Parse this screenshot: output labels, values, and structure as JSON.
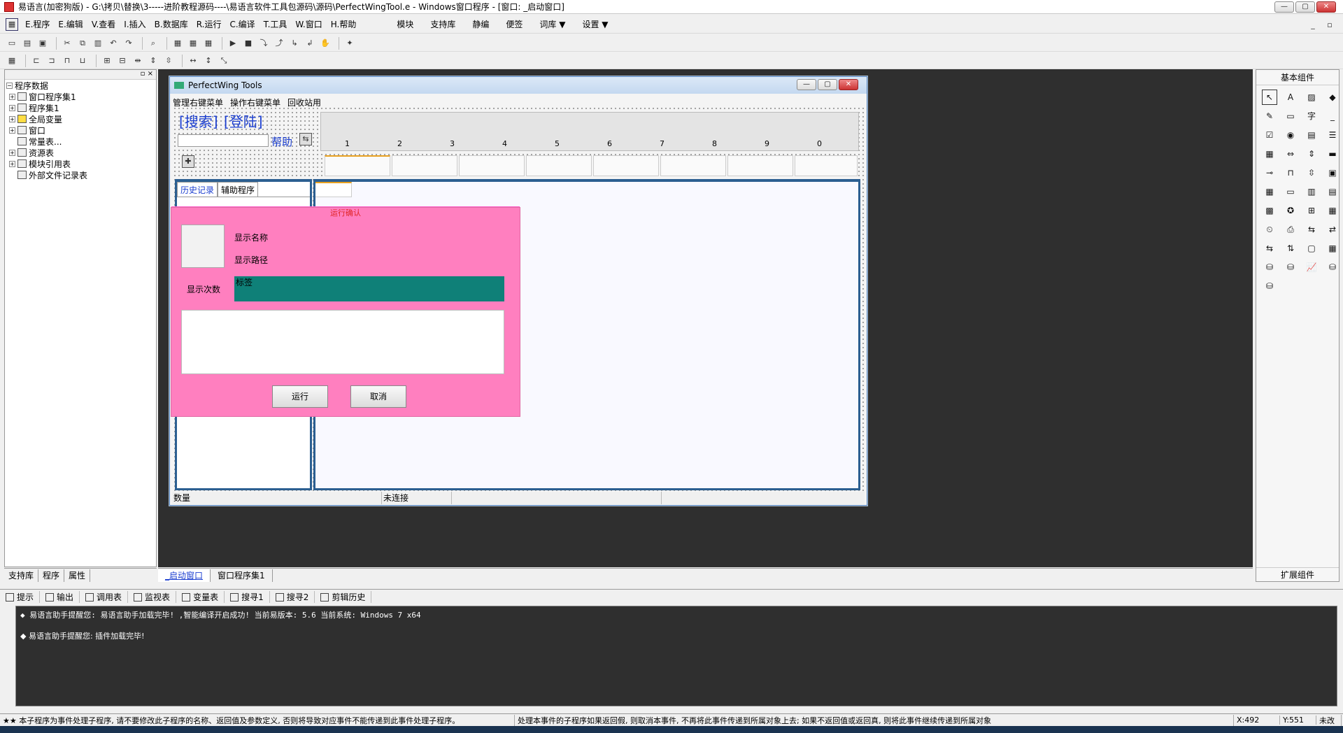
{
  "window": {
    "title": "易语言(加密狗版) - G:\\拷贝\\替换\\3-----进阶教程源码----\\易语言软件工具包源码\\源码\\PerfectWingTool.e - Windows窗口程序 - [窗口: _启动窗口]",
    "min_label": "—",
    "max_label": "▢",
    "close_label": "✕"
  },
  "menu": {
    "items": [
      "E.程序",
      "E.编辑",
      "V.查看",
      "I.插入",
      "B.数据库",
      "R.运行",
      "C.编译",
      "T.工具",
      "W.窗口",
      "H.帮助"
    ],
    "tools": [
      "模块",
      "支持库",
      "静编",
      "便签",
      "词库 ▼",
      "设置 ▼"
    ]
  },
  "tree": {
    "root": "程序数据",
    "items": [
      "窗口程序集1",
      "程序集1",
      "全局变量",
      "窗口",
      "常量表...",
      "资源表",
      "模块引用表",
      "外部文件记录表"
    ]
  },
  "left_tabs": [
    "支持库",
    "程序",
    "属性"
  ],
  "designer": {
    "title": "PerfectWing Tools",
    "menu": [
      "管理右键菜单",
      "操作右键菜单",
      "回收站用"
    ],
    "search_link": "[搜索]",
    "login_link": "[登陆]",
    "help_link": "帮助",
    "numbers": [
      "1",
      "2",
      "3",
      "4",
      "5",
      "6",
      "7",
      "8",
      "9",
      "0"
    ],
    "list_tabs": [
      "历史记录",
      "辅助程序"
    ],
    "status": [
      "数量",
      "未连接"
    ]
  },
  "dialog": {
    "title": "运行确认",
    "name_label": "显示名称",
    "path_label": "显示路径",
    "count_label": "显示次数",
    "teal_label": "标签",
    "run_button": "运行",
    "cancel_button": "取消"
  },
  "palette": {
    "header": "基本组件",
    "footer": "扩展组件"
  },
  "doc_tabs": [
    "_启动窗口",
    "窗口程序集1"
  ],
  "output_tabs": [
    "提示",
    "输出",
    "调用表",
    "监视表",
    "变量表",
    "搜寻1",
    "搜寻2",
    "剪辑历史"
  ],
  "output": {
    "line1": "◆ 易语言助手提醒您: 易语言助手加载完毕!  ,智能编译开启成功!  当前易版本: 5.6  当前系统: Windows 7 x64",
    "line2": "◆ 易语言助手提醒您: 插件加载完毕!"
  },
  "statusbar": {
    "msg1": "★★ 本子程序为事件处理子程序, 请不要修改此子程序的名称、返回值及参数定义, 否则将导致对应事件不能传递到此事件处理子程序。",
    "msg2": "处理本事件的子程序如果返回假, 则取消本事件, 不再将此事件传递到所属对象上去; 如果不返回值或返回真, 则将此事件继续传递到所属对象",
    "x": "X:492",
    "y": "Y:551",
    "mode": "未改"
  }
}
